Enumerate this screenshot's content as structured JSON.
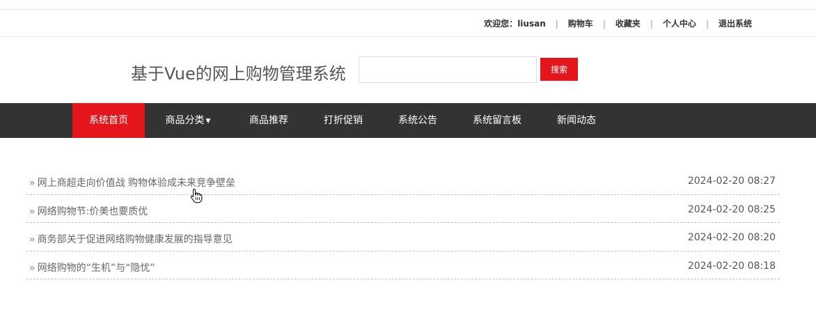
{
  "topbar": {
    "welcome_prefix": "欢迎您：",
    "username": "liusan",
    "separator": "|",
    "links": [
      "购物车",
      "收藏夹",
      "个人中心",
      "退出系统"
    ]
  },
  "header": {
    "site_title": "基于Vue的网上购物管理系统",
    "search": {
      "value": "",
      "placeholder": ""
    },
    "search_button": "搜索"
  },
  "nav": {
    "items": [
      "系统首页",
      "商品分类",
      "商品推荐",
      "打折促销",
      "系统公告",
      "系统留言板",
      "新闻动态"
    ],
    "active": "系统首页",
    "dropdown_icon": "chevron-down-icon"
  },
  "news": {
    "bullet": "»",
    "items": [
      {
        "title": "网上商超走向价值战 购物体验成未来竞争壁垒",
        "date": "2024-02-20 08:27"
      },
      {
        "title": "网络购物节:价美也要质优",
        "date": "2024-02-20 08:25"
      },
      {
        "title": "商务部关于促进网络购物健康发展的指导意见",
        "date": "2024-02-20 08:20"
      },
      {
        "title": "网络购物的“生机”与“隐忧”",
        "date": "2024-02-20 08:18"
      }
    ]
  },
  "colors": {
    "accent": "#e4161c",
    "nav_background": "#333333"
  },
  "cursor_icon": "hand-pointer-icon"
}
